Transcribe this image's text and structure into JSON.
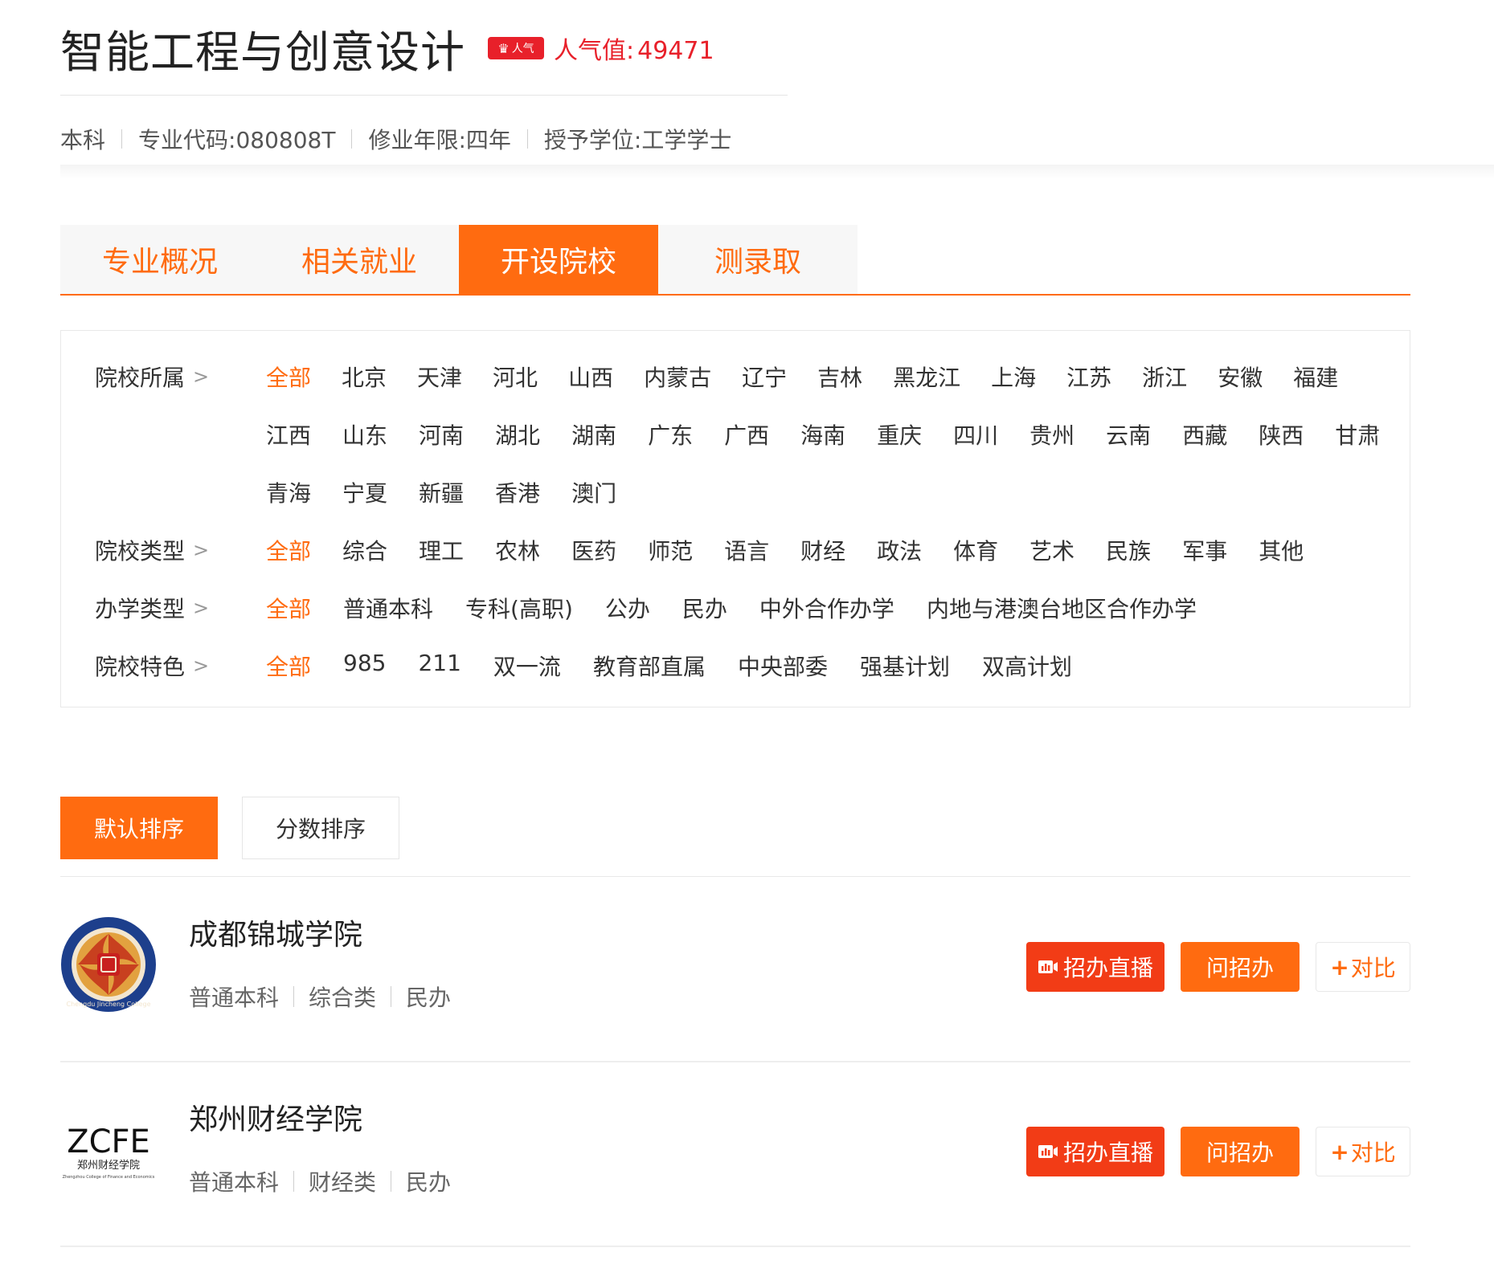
{
  "header": {
    "title": "智能工程与创意设计",
    "badge_label": "人气",
    "popularity_label": "人气值:",
    "popularity_value": "49471",
    "meta": [
      "本科",
      "专业代码:080808T",
      "修业年限:四年",
      "授予学位:工学学士"
    ]
  },
  "tabs": [
    {
      "label": "专业概况",
      "active": false
    },
    {
      "label": "相关就业",
      "active": false
    },
    {
      "label": "开设院校",
      "active": true
    },
    {
      "label": "测录取",
      "active": false
    }
  ],
  "filters": {
    "region": {
      "label": "院校所属",
      "options": [
        "全部",
        "北京",
        "天津",
        "河北",
        "山西",
        "内蒙古",
        "辽宁",
        "吉林",
        "黑龙江",
        "上海",
        "江苏",
        "浙江",
        "安徽",
        "福建",
        "江西",
        "山东",
        "河南",
        "湖北",
        "湖南",
        "广东",
        "广西",
        "海南",
        "重庆",
        "四川",
        "贵州",
        "云南",
        "西藏",
        "陕西",
        "甘肃",
        "青海",
        "宁夏",
        "新疆",
        "香港",
        "澳门"
      ],
      "selected": "全部"
    },
    "school_type": {
      "label": "院校类型",
      "options": [
        "全部",
        "综合",
        "理工",
        "农林",
        "医药",
        "师范",
        "语言",
        "财经",
        "政法",
        "体育",
        "艺术",
        "民族",
        "军事",
        "其他"
      ],
      "selected": "全部"
    },
    "run_type": {
      "label": "办学类型",
      "options": [
        "全部",
        "普通本科",
        "专科(高职)",
        "公办",
        "民办",
        "中外合作办学",
        "内地与港澳台地区合作办学"
      ],
      "selected": "全部"
    },
    "feature": {
      "label": "院校特色",
      "options": [
        "全部",
        "985",
        "211",
        "双一流",
        "教育部直属",
        "中央部委",
        "强基计划",
        "双高计划"
      ],
      "selected": "全部"
    }
  },
  "sort": {
    "default_label": "默认排序",
    "score_label": "分数排序"
  },
  "schools": [
    {
      "name": "成都锦城学院",
      "tags": [
        "普通本科",
        "综合类",
        "民办"
      ],
      "logo_text": "Chengdu Jincheng College",
      "live_label": "招办直播",
      "ask_label": "问招办",
      "compare_label": "对比"
    },
    {
      "name": "郑州财经学院",
      "tags": [
        "普通本科",
        "财经类",
        "民办"
      ],
      "logo_text": "ZCFE",
      "logo_cn": "郑州财经学院",
      "logo_en": "Zhengzhou College of Finance and Economics",
      "live_label": "招办直播",
      "ask_label": "问招办",
      "compare_label": "对比"
    }
  ],
  "colors": {
    "accent": "#ff6b10",
    "red": "#e8202a",
    "live": "#f23c16"
  }
}
